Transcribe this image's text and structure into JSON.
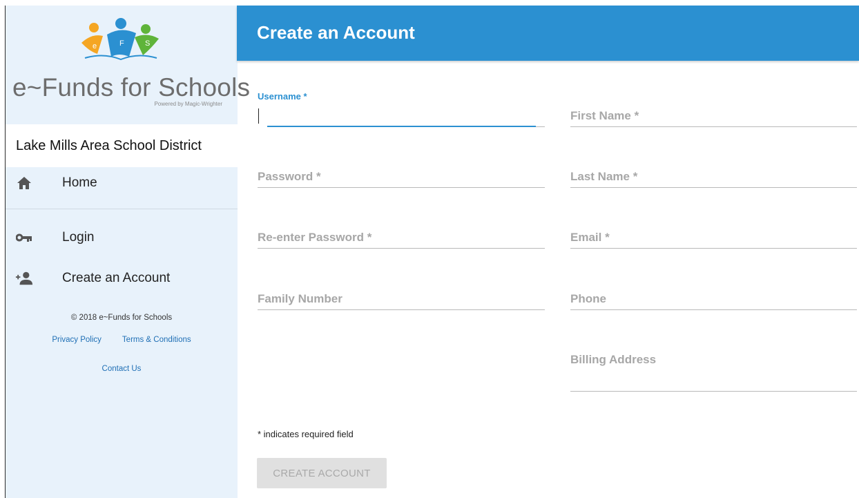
{
  "brand": {
    "logo_letters": [
      "e",
      "F",
      "S"
    ],
    "name": "e~Funds for Schools",
    "tagline": "Powered by Magic-Wrighter"
  },
  "district": "Lake Mills Area School District",
  "nav": {
    "home": {
      "label": "Home",
      "icon": "home-icon"
    },
    "login": {
      "label": "Login",
      "icon": "key-icon"
    },
    "create": {
      "label": "Create an Account",
      "icon": "add-person-icon"
    }
  },
  "footer": {
    "copyright": "© 2018 e~Funds for Schools",
    "privacy": "Privacy Policy",
    "terms": "Terms & Conditions",
    "contact": "Contact Us"
  },
  "header": {
    "title": "Create an Account"
  },
  "form": {
    "username": {
      "label": "Username *",
      "value": ""
    },
    "password": {
      "label": "Password *"
    },
    "reenter_password": {
      "label": "Re-enter Password *"
    },
    "family_number": {
      "label": "Family Number"
    },
    "first_name": {
      "label": "First Name *"
    },
    "last_name": {
      "label": "Last Name *"
    },
    "email": {
      "label": "Email *"
    },
    "phone": {
      "label": "Phone"
    },
    "billing_address": {
      "label": "Billing Address"
    },
    "required_note": "* indicates required field",
    "submit_label": "CREATE ACCOUNT"
  },
  "colors": {
    "accent": "#2b90d1",
    "sidebar_bg": "#e8f2fb",
    "label_gray": "#a7a7a7",
    "button_disabled_bg": "#e0e0e0",
    "logo_orange": "#f5a623",
    "logo_blue": "#2b90d1",
    "logo_green": "#5fb43a"
  }
}
